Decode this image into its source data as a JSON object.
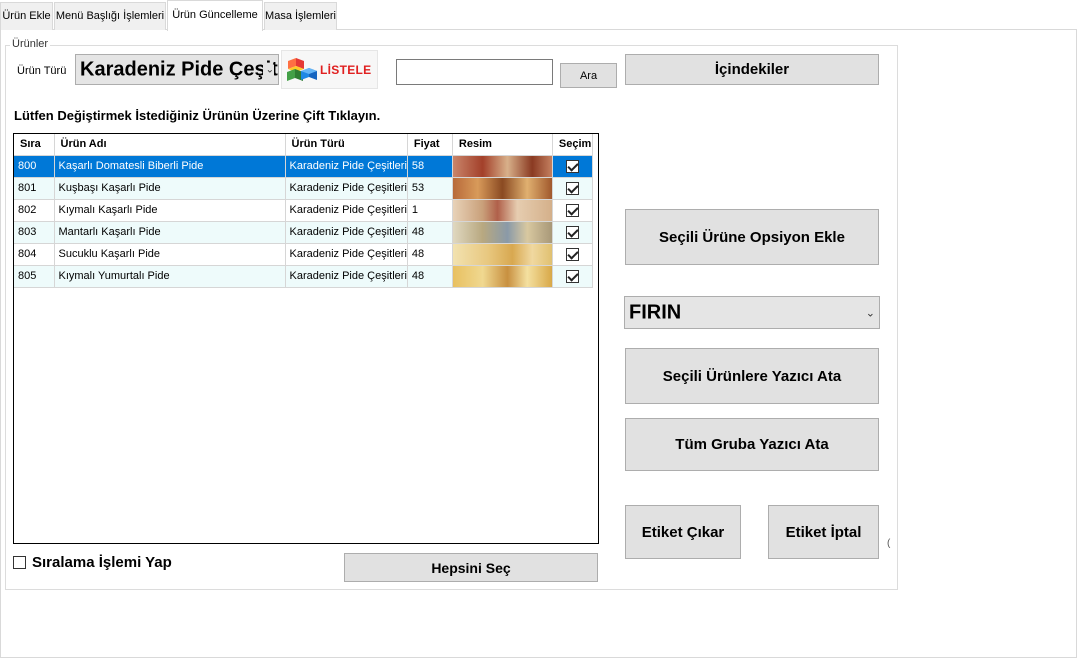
{
  "tabs": [
    {
      "label": "Ürün Ekle",
      "active": false
    },
    {
      "label": "Menü Başlığı İşlemleri",
      "active": false
    },
    {
      "label": "Ürün Güncelleme",
      "active": true
    },
    {
      "label": "Masa İşlemleri",
      "active": false
    }
  ],
  "group": {
    "title": "Ürünler"
  },
  "filter": {
    "label": "Ürün Türü",
    "selected": "Karadeniz Pide Çeşitleri",
    "list_button": "LİSTELE",
    "search_value": "",
    "search_button": "Ara"
  },
  "contents_button": "İçindekiler",
  "instruction": "Lütfen Değiştirmek İstediğiniz Ürünün Üzerine Çift Tıklayın.",
  "table": {
    "columns": [
      "Sıra",
      "Ürün Adı",
      "Ürün Türü",
      "Fiyat",
      "Resim",
      "Seçim"
    ],
    "rows": [
      {
        "sira": "800",
        "ad": "Kaşarlı Domatesli Biberli Pide",
        "tur": "Karadeniz Pide Çeşitleri",
        "fiyat": "58",
        "secim": true
      },
      {
        "sira": "801",
        "ad": "Kuşbaşı Kaşarlı Pide",
        "tur": "Karadeniz Pide Çeşitleri",
        "fiyat": "53",
        "secim": true
      },
      {
        "sira": "802",
        "ad": "Kıymalı Kaşarlı Pide",
        "tur": "Karadeniz Pide Çeşitleri",
        "fiyat": "1",
        "secim": true
      },
      {
        "sira": "803",
        "ad": "Mantarlı Kaşarlı Pide",
        "tur": "Karadeniz Pide Çeşitleri",
        "fiyat": "48",
        "secim": true
      },
      {
        "sira": "804",
        "ad": "Sucuklu Kaşarlı Pide",
        "tur": "Karadeniz Pide Çeşitleri",
        "fiyat": "48",
        "secim": true
      },
      {
        "sira": "805",
        "ad": "Kıymalı Yumurtalı Pide",
        "tur": "Karadeniz Pide Çeşitleri",
        "fiyat": "48",
        "secim": true
      }
    ],
    "selected_index": 0
  },
  "sort": {
    "label": "Sıralama İşlemi Yap",
    "checked": false
  },
  "select_all_button": "Hepsini Seç",
  "option_button": "Seçili Ürüne Opsiyon Ekle",
  "printer": {
    "selected": "FIRIN"
  },
  "assign_printer_button": "Seçili Ürünlere Yazıcı Ata",
  "assign_group_button": "Tüm Gruba Yazıcı Ata",
  "label_out_button": "Etiket Çıkar",
  "label_cancel_button": "Etiket İptal",
  "side_glyph": "(",
  "colors": {
    "selection": "#0078d7",
    "alt_row": "#eefbfb",
    "button_face": "#e1e1e1",
    "listele_text": "#e02020"
  }
}
